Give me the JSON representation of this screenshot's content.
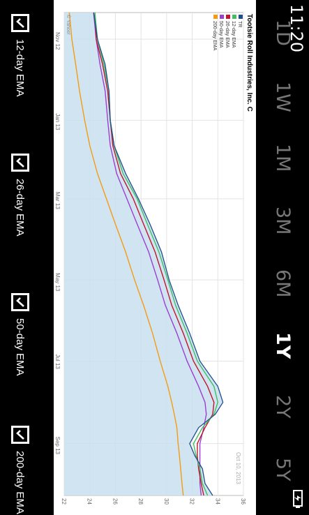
{
  "status": {
    "time": "11:20"
  },
  "ranges": [
    {
      "label": "1D",
      "active": false
    },
    {
      "label": "1W",
      "active": false
    },
    {
      "label": "1M",
      "active": false
    },
    {
      "label": "3M",
      "active": false
    },
    {
      "label": "6M",
      "active": false
    },
    {
      "label": "1Y",
      "active": true
    },
    {
      "label": "2Y",
      "active": false
    },
    {
      "label": "5Y",
      "active": false
    }
  ],
  "checkboxes": [
    {
      "label": "12-day EMA",
      "checked": true
    },
    {
      "label": "26-day EMA",
      "checked": true
    },
    {
      "label": "50-day EMA",
      "checked": true
    },
    {
      "label": "200-day EMA",
      "checked": true
    }
  ],
  "chart_data": {
    "type": "line",
    "title": "Tootsie Roll Industries, Inc. C",
    "date_label": "Oct 10, 2013",
    "credit": "© Yahoo!",
    "x_ticks": [
      "Nov 12",
      "Jan 13",
      "Mar 13",
      "May 13",
      "Jul 13",
      "Sep 13"
    ],
    "y_ticks": [
      22,
      24,
      26,
      28,
      30,
      32,
      34,
      36
    ],
    "ylim": [
      22,
      36
    ],
    "x": [
      "2012-10-12",
      "2012-11-01",
      "2012-11-20",
      "2012-12-10",
      "2013-01-01",
      "2013-01-20",
      "2013-02-10",
      "2013-03-01",
      "2013-03-20",
      "2013-04-10",
      "2013-05-01",
      "2013-05-20",
      "2013-06-10",
      "2013-07-01",
      "2013-07-20",
      "2013-08-01",
      "2013-08-10",
      "2013-08-20",
      "2013-09-01",
      "2013-09-10",
      "2013-09-20",
      "2013-10-01",
      "2013-10-10"
    ],
    "legend": [
      "TR",
      "12-day EMA",
      "26-day EMA",
      "50-day EMA",
      "200-day EMA"
    ],
    "colors": {
      "TR": "#1f4e8c",
      "ema12": "#3fbf5f",
      "ema26": "#c0152a",
      "ema50": "#9b3fd1",
      "ema200": "#f39c12",
      "area": "#c9dff0"
    },
    "series": [
      {
        "name": "TR",
        "values": [
          24.3,
          24.6,
          25.2,
          25.5,
          25.6,
          25.9,
          26.8,
          27.8,
          28.7,
          29.6,
          30.2,
          30.9,
          31.8,
          32.6,
          34.0,
          34.4,
          33.8,
          32.5,
          31.8,
          32.2,
          32.8,
          33.0,
          33.6
        ]
      },
      {
        "name": "12-day EMA",
        "values": [
          24.4,
          24.6,
          25.1,
          25.5,
          25.6,
          25.9,
          26.6,
          27.7,
          28.5,
          29.4,
          30.1,
          30.7,
          31.6,
          32.4,
          33.7,
          34.0,
          33.7,
          32.8,
          32.1,
          32.3,
          32.6,
          32.8,
          33.2
        ]
      },
      {
        "name": "26-day EMA",
        "values": [
          24.4,
          24.5,
          25.0,
          25.4,
          25.6,
          25.8,
          26.4,
          27.4,
          28.2,
          29.1,
          29.8,
          30.4,
          31.3,
          32.1,
          33.2,
          33.7,
          33.6,
          33.0,
          32.4,
          32.4,
          32.5,
          32.7,
          32.9
        ]
      },
      {
        "name": "50-day EMA",
        "values": [
          24.3,
          24.5,
          24.8,
          25.2,
          25.4,
          25.6,
          26.1,
          26.9,
          27.7,
          28.6,
          29.3,
          29.9,
          30.8,
          31.6,
          32.5,
          33.0,
          33.1,
          32.9,
          32.6,
          32.6,
          32.6,
          32.6,
          32.7
        ]
      },
      {
        "name": "200-day EMA",
        "values": [
          22.4,
          22.6,
          22.9,
          23.2,
          23.6,
          24.0,
          24.6,
          25.3,
          26.0,
          26.8,
          27.5,
          28.2,
          28.9,
          29.5,
          30.1,
          30.4,
          30.6,
          30.8,
          30.9,
          31.0,
          31.1,
          31.2,
          31.3
        ]
      }
    ]
  }
}
